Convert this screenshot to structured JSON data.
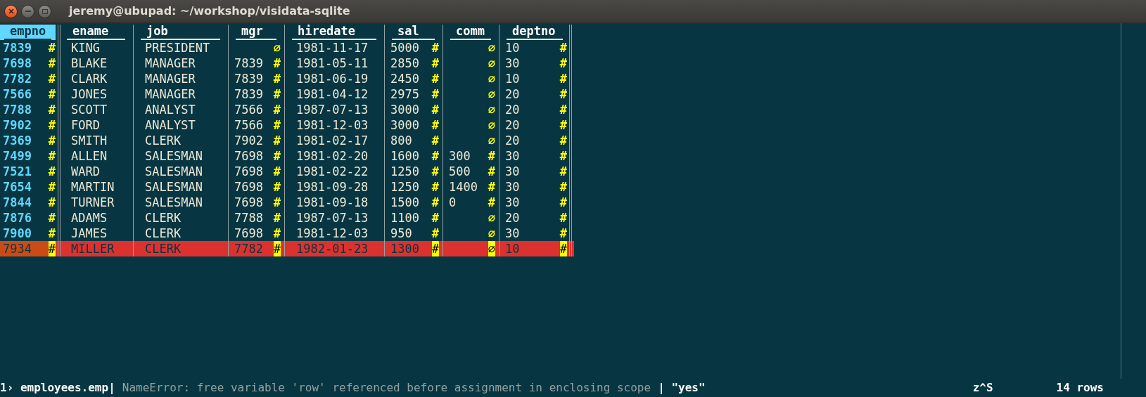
{
  "window": {
    "title": "jeremy@ubupad: ~/workshop/visidata-sqlite"
  },
  "table": {
    "columns": [
      {
        "name": "empno",
        "selected": true,
        "key": true
      },
      {
        "name": "ename",
        "selected": false,
        "key": false
      },
      {
        "name": "job",
        "selected": false,
        "key": false
      },
      {
        "name": "mgr",
        "selected": false,
        "key": false
      },
      {
        "name": "hiredate",
        "selected": false,
        "key": false
      },
      {
        "name": "sal",
        "selected": false,
        "key": false
      },
      {
        "name": "comm",
        "selected": false,
        "key": false
      },
      {
        "name": "deptno",
        "selected": false,
        "key": false
      }
    ],
    "rows": [
      {
        "selected": false,
        "cells": [
          {
            "kind": "number",
            "text": "7839",
            "mark": "#"
          },
          {
            "kind": "text",
            "text": "KING"
          },
          {
            "kind": "text",
            "text": "PRESIDENT"
          },
          {
            "kind": "null",
            "text": "∅"
          },
          {
            "kind": "text",
            "text": "1981-11-17"
          },
          {
            "kind": "number",
            "text": "5000",
            "mark": "#"
          },
          {
            "kind": "null",
            "text": "∅"
          },
          {
            "kind": "number",
            "text": "10",
            "mark": "#"
          }
        ]
      },
      {
        "selected": false,
        "cells": [
          {
            "kind": "number",
            "text": "7698",
            "mark": "#"
          },
          {
            "kind": "text",
            "text": "BLAKE"
          },
          {
            "kind": "text",
            "text": "MANAGER"
          },
          {
            "kind": "number",
            "text": "7839",
            "mark": "#"
          },
          {
            "kind": "text",
            "text": "1981-05-11"
          },
          {
            "kind": "number",
            "text": "2850",
            "mark": "#"
          },
          {
            "kind": "null",
            "text": "∅"
          },
          {
            "kind": "number",
            "text": "30",
            "mark": "#"
          }
        ]
      },
      {
        "selected": false,
        "cells": [
          {
            "kind": "number",
            "text": "7782",
            "mark": "#"
          },
          {
            "kind": "text",
            "text": "CLARK"
          },
          {
            "kind": "text",
            "text": "MANAGER"
          },
          {
            "kind": "number",
            "text": "7839",
            "mark": "#"
          },
          {
            "kind": "text",
            "text": "1981-06-19"
          },
          {
            "kind": "number",
            "text": "2450",
            "mark": "#"
          },
          {
            "kind": "null",
            "text": "∅"
          },
          {
            "kind": "number",
            "text": "10",
            "mark": "#"
          }
        ]
      },
      {
        "selected": false,
        "cells": [
          {
            "kind": "number",
            "text": "7566",
            "mark": "#"
          },
          {
            "kind": "text",
            "text": "JONES"
          },
          {
            "kind": "text",
            "text": "MANAGER"
          },
          {
            "kind": "number",
            "text": "7839",
            "mark": "#"
          },
          {
            "kind": "text",
            "text": "1981-04-12"
          },
          {
            "kind": "number",
            "text": "2975",
            "mark": "#"
          },
          {
            "kind": "null",
            "text": "∅"
          },
          {
            "kind": "number",
            "text": "20",
            "mark": "#"
          }
        ]
      },
      {
        "selected": false,
        "cells": [
          {
            "kind": "number",
            "text": "7788",
            "mark": "#"
          },
          {
            "kind": "text",
            "text": "SCOTT"
          },
          {
            "kind": "text",
            "text": "ANALYST"
          },
          {
            "kind": "number",
            "text": "7566",
            "mark": "#"
          },
          {
            "kind": "text",
            "text": "1987-07-13"
          },
          {
            "kind": "number",
            "text": "3000",
            "mark": "#"
          },
          {
            "kind": "null",
            "text": "∅"
          },
          {
            "kind": "number",
            "text": "20",
            "mark": "#"
          }
        ]
      },
      {
        "selected": false,
        "cells": [
          {
            "kind": "number",
            "text": "7902",
            "mark": "#"
          },
          {
            "kind": "text",
            "text": "FORD"
          },
          {
            "kind": "text",
            "text": "ANALYST"
          },
          {
            "kind": "number",
            "text": "7566",
            "mark": "#"
          },
          {
            "kind": "text",
            "text": "1981-12-03"
          },
          {
            "kind": "number",
            "text": "3000",
            "mark": "#"
          },
          {
            "kind": "null",
            "text": "∅"
          },
          {
            "kind": "number",
            "text": "20",
            "mark": "#"
          }
        ]
      },
      {
        "selected": false,
        "cells": [
          {
            "kind": "number",
            "text": "7369",
            "mark": "#"
          },
          {
            "kind": "text",
            "text": "SMITH"
          },
          {
            "kind": "text",
            "text": "CLERK"
          },
          {
            "kind": "number",
            "text": "7902",
            "mark": "#"
          },
          {
            "kind": "text",
            "text": "1981-02-17"
          },
          {
            "kind": "number",
            "text": "800",
            "mark": "#"
          },
          {
            "kind": "null",
            "text": "∅"
          },
          {
            "kind": "number",
            "text": "20",
            "mark": "#"
          }
        ]
      },
      {
        "selected": false,
        "cells": [
          {
            "kind": "number",
            "text": "7499",
            "mark": "#"
          },
          {
            "kind": "text",
            "text": "ALLEN"
          },
          {
            "kind": "text",
            "text": "SALESMAN"
          },
          {
            "kind": "number",
            "text": "7698",
            "mark": "#"
          },
          {
            "kind": "text",
            "text": "1981-02-20"
          },
          {
            "kind": "number",
            "text": "1600",
            "mark": "#"
          },
          {
            "kind": "number",
            "text": "300",
            "mark": "#"
          },
          {
            "kind": "number",
            "text": "30",
            "mark": "#"
          }
        ]
      },
      {
        "selected": false,
        "cells": [
          {
            "kind": "number",
            "text": "7521",
            "mark": "#"
          },
          {
            "kind": "text",
            "text": "WARD"
          },
          {
            "kind": "text",
            "text": "SALESMAN"
          },
          {
            "kind": "number",
            "text": "7698",
            "mark": "#"
          },
          {
            "kind": "text",
            "text": "1981-02-22"
          },
          {
            "kind": "number",
            "text": "1250",
            "mark": "#"
          },
          {
            "kind": "number",
            "text": "500",
            "mark": "#"
          },
          {
            "kind": "number",
            "text": "30",
            "mark": "#"
          }
        ]
      },
      {
        "selected": false,
        "cells": [
          {
            "kind": "number",
            "text": "7654",
            "mark": "#"
          },
          {
            "kind": "text",
            "text": "MARTIN"
          },
          {
            "kind": "text",
            "text": "SALESMAN"
          },
          {
            "kind": "number",
            "text": "7698",
            "mark": "#"
          },
          {
            "kind": "text",
            "text": "1981-09-28"
          },
          {
            "kind": "number",
            "text": "1250",
            "mark": "#"
          },
          {
            "kind": "number",
            "text": "1400",
            "mark": "#"
          },
          {
            "kind": "number",
            "text": "30",
            "mark": "#"
          }
        ]
      },
      {
        "selected": false,
        "cells": [
          {
            "kind": "number",
            "text": "7844",
            "mark": "#"
          },
          {
            "kind": "text",
            "text": "TURNER"
          },
          {
            "kind": "text",
            "text": "SALESMAN"
          },
          {
            "kind": "number",
            "text": "7698",
            "mark": "#"
          },
          {
            "kind": "text",
            "text": "1981-09-18"
          },
          {
            "kind": "number",
            "text": "1500",
            "mark": "#"
          },
          {
            "kind": "number",
            "text": "0",
            "mark": "#"
          },
          {
            "kind": "number",
            "text": "30",
            "mark": "#"
          }
        ]
      },
      {
        "selected": false,
        "cells": [
          {
            "kind": "number",
            "text": "7876",
            "mark": "#"
          },
          {
            "kind": "text",
            "text": "ADAMS"
          },
          {
            "kind": "text",
            "text": "CLERK"
          },
          {
            "kind": "number",
            "text": "7788",
            "mark": "#"
          },
          {
            "kind": "text",
            "text": "1987-07-13"
          },
          {
            "kind": "number",
            "text": "1100",
            "mark": "#"
          },
          {
            "kind": "null",
            "text": "∅"
          },
          {
            "kind": "number",
            "text": "20",
            "mark": "#"
          }
        ]
      },
      {
        "selected": false,
        "cells": [
          {
            "kind": "number",
            "text": "7900",
            "mark": "#"
          },
          {
            "kind": "text",
            "text": "JAMES"
          },
          {
            "kind": "text",
            "text": "CLERK"
          },
          {
            "kind": "number",
            "text": "7698",
            "mark": "#"
          },
          {
            "kind": "text",
            "text": "1981-12-03"
          },
          {
            "kind": "number",
            "text": "950",
            "mark": "#"
          },
          {
            "kind": "null",
            "text": "∅"
          },
          {
            "kind": "number",
            "text": "30",
            "mark": "#"
          }
        ]
      },
      {
        "selected": true,
        "cells": [
          {
            "kind": "number",
            "text": "7934",
            "mark": "#"
          },
          {
            "kind": "text",
            "text": "MILLER"
          },
          {
            "kind": "text",
            "text": "CLERK"
          },
          {
            "kind": "number",
            "text": "7782",
            "mark": "#"
          },
          {
            "kind": "text",
            "text": "1982-01-23"
          },
          {
            "kind": "number",
            "text": "1300",
            "mark": "#"
          },
          {
            "kind": "null",
            "text": "∅"
          },
          {
            "kind": "number",
            "text": "10",
            "mark": "#"
          }
        ]
      }
    ]
  },
  "status_bar": {
    "sheet": "1› employees.emp|",
    "message": "NameError: free variable 'row' referenced before assignment in enclosing scope",
    "value": "| \"yes\"",
    "keystrokes": "z^S",
    "row_count": "14 rows"
  }
}
